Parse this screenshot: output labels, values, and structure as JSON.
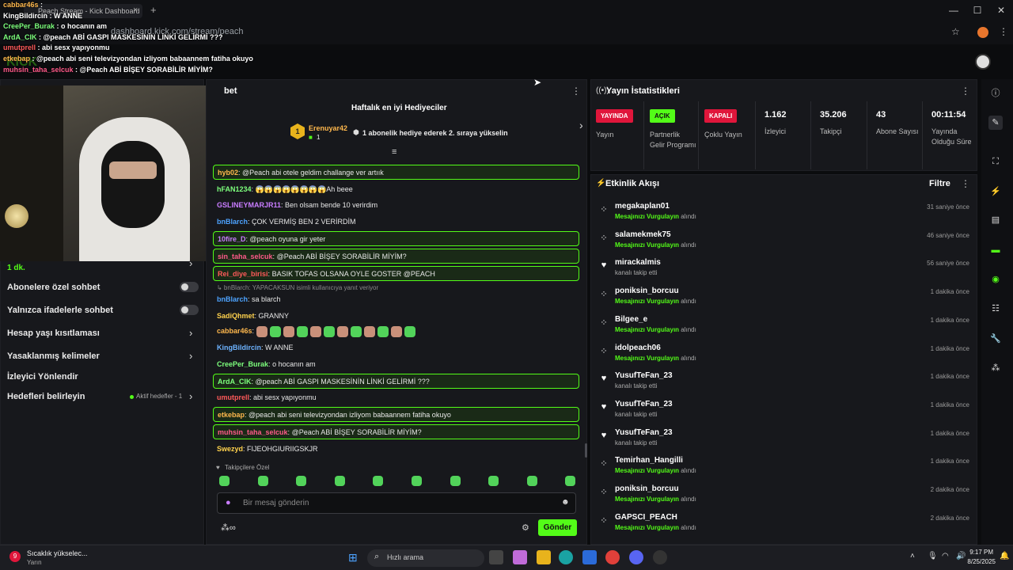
{
  "browser": {
    "tab_title": "Peach Stream - Kick Dashboard",
    "url": "dashboard.kick.com/stream/peach"
  },
  "overlay_chat": [
    {
      "user": "cabbar46s",
      "text": "",
      "color": "#ffb84d"
    },
    {
      "user": "KingBildircin",
      "text": "W ANNE",
      "color": "#ffffff"
    },
    {
      "user": "CreePer_Burak",
      "text": "o hocanın am",
      "color": "#7dff7d"
    },
    {
      "user": "ArdA_CIK",
      "text": "@peach ABİ GASPI MASKESİNİN LİNKİ GELİRMİ ???",
      "color": "#7dff7d"
    },
    {
      "user": "umutprell",
      "text": "abi sesx yapıyonmu",
      "color": "#ff5a5a"
    },
    {
      "user": "etkebap",
      "text": "@peach abi seni televizyondan izliyom babaannem fatiha okuyo",
      "color": "#ffb84d"
    },
    {
      "user": "muhsin_taha_selcuk",
      "text": "@Peach ABİ BİŞEY SORABİLİR MİYİM?",
      "color": "#ff5a8a"
    }
  ],
  "chat_panel": {
    "title": "Sohbet",
    "top_gifters_title": "Haftalık en iyi Hediyeciler",
    "top_gifter_name": "Erenuyar42",
    "top_gifter_count": "1",
    "rank_text": "1 abonelik hediye ederek 2. sıraya yükselin",
    "messages": [
      {
        "user": "hyb02",
        "text": "@Peach abi otele geldim challange ver artıık",
        "color": "#ffb84d",
        "hl": true
      },
      {
        "user": "hFAN1234",
        "text": "😱😱😱😱😱😱😱😱Ah beee",
        "color": "#7dff7d",
        "hl": false
      },
      {
        "user": "GSLINEYMARJR11",
        "text": "Ben olsam bende 10 verirdim",
        "color": "#c97dff",
        "hl": false
      },
      {
        "user": "bnBlarch",
        "text": "ÇOK VERMİŞ BEN 2 VERİRDİM",
        "color": "#4da3ff",
        "hl": false
      },
      {
        "user": "10fire_D",
        "text": "@peach oyuna gir yeter",
        "color": "#c97dff",
        "hl": true
      },
      {
        "user": "sin_taha_selcuk",
        "text": "@Peach ABİ BİŞEY SORABİLİR MİYİM?",
        "color": "#ff5a8a",
        "hl": true
      },
      {
        "user": "Rei_diye_birisi",
        "text": "BASIK TOFAS OLSANA OYLE GOSTER @PEACH",
        "color": "#ff5a5a",
        "hl": true
      },
      {
        "user": "",
        "text": "↳ bnBlarch: YAPACAKSUN isimli kullanıcıya yanıt veriyor",
        "color": "#8a8a8a",
        "hl": false,
        "reply": true
      },
      {
        "user": "bnBlarch",
        "text": "sa blarch",
        "color": "#4da3ff",
        "hl": false
      },
      {
        "user": "SadiQhmet",
        "text": "GRANNY",
        "color": "#ffd24d",
        "hl": false
      },
      {
        "user": "cabbar46s",
        "text": "",
        "color": "#ffb84d",
        "hl": false,
        "emotes": 12
      },
      {
        "user": "KingBildircin",
        "text": "W ANNE",
        "color": "#6db3ff",
        "hl": false
      },
      {
        "user": "CreePer_Burak",
        "text": "o hocanın am",
        "color": "#7dff7d",
        "hl": false
      },
      {
        "user": "ArdA_CIK",
        "text": "@peach ABİ GASPI MASKESİNİN LİNKİ GELİRMİ ???",
        "color": "#7dff7d",
        "hl": true
      },
      {
        "user": "umutprell",
        "text": "abi sesx yapıyonmu",
        "color": "#ff5a5a",
        "hl": false
      },
      {
        "user": "etkebap",
        "text": "@peach abi seni televizyondan izliyom babaannem fatiha okuyo",
        "color": "#ffb84d",
        "hl": true
      },
      {
        "user": "muhsin_taha_selcuk",
        "text": "@Peach ABİ BİŞEY SORABİLİR MİYİM?",
        "color": "#ff5a8a",
        "hl": true
      },
      {
        "user": "Swezyd",
        "text": "FIJEOHGIURIIGSKJR",
        "color": "#ffd24d",
        "hl": false
      }
    ],
    "followers_only_label": "Takipçilere Özel",
    "input_placeholder": "Bir mesaj gönderin",
    "send_label": "Gönder"
  },
  "settings": {
    "follow_delay": "1 dk.",
    "rows": [
      {
        "label": "Abonelere özel sohbet",
        "type": "toggle"
      },
      {
        "label": "Yalnızca ifadelerle sohbet",
        "type": "toggle"
      },
      {
        "label": "Hesap yaşı kısıtlaması",
        "type": "chevron"
      },
      {
        "label": "Yasaklanmış kelimeler",
        "type": "chevron"
      },
      {
        "label": "İzleyici Yönlendir",
        "type": "none"
      },
      {
        "label": "Hedefleri belirleyin",
        "type": "chevron",
        "extra": "Aktif hedefler - 1"
      }
    ]
  },
  "stats": {
    "title": "Yayın İstatistikleri",
    "items": [
      {
        "badge": "YAYINDA",
        "badge_color": "#e0163b",
        "label": "Yayın"
      },
      {
        "badge": "AÇIK",
        "badge_color": "#53fc18",
        "label": "Partnerlik Gelir Programı"
      },
      {
        "badge": "KAPALI",
        "badge_color": "#e0163b",
        "label": "Çoklu Yayın"
      },
      {
        "value": "1.162",
        "label": "İzleyici"
      },
      {
        "value": "35.206",
        "label": "Takipçi"
      },
      {
        "value": "43",
        "label": "Abone Sayısı"
      },
      {
        "value": "00:11:54",
        "label": "Yayında Olduğu Süre"
      }
    ]
  },
  "events": {
    "title": "Etkinlik Akışı",
    "filter_label": "Filtre",
    "items": [
      {
        "name": "megakaplan01",
        "type": "msg",
        "time": "31 saniye önce"
      },
      {
        "name": "salamekmek75",
        "type": "msg",
        "time": "46 saniye önce"
      },
      {
        "name": "mirackalmis",
        "type": "follow",
        "time": "56 saniye önce"
      },
      {
        "name": "poniksin_borcuu",
        "type": "msg",
        "time": "1 dakika önce"
      },
      {
        "name": "Bilgee_e",
        "type": "msg",
        "time": "1 dakika önce"
      },
      {
        "name": "idolpeach06",
        "type": "msg",
        "time": "1 dakika önce"
      },
      {
        "name": "YusufTeFan_23",
        "type": "follow",
        "time": "1 dakika önce"
      },
      {
        "name": "YusufTeFan_23",
        "type": "follow",
        "time": "1 dakika önce"
      },
      {
        "name": "YusufTeFan_23",
        "type": "follow",
        "time": "1 dakika önce"
      },
      {
        "name": "Temirhan_Hangilli",
        "type": "msg",
        "time": "1 dakika önce"
      },
      {
        "name": "poniksin_borcuu",
        "type": "msg",
        "time": "2 dakika önce"
      },
      {
        "name": "GAPSCI_PEACH",
        "type": "msg",
        "time": "2 dakika önce"
      }
    ],
    "msg_highlight": "Mesajınızı Vurgulayın",
    "msg_suffix": "alındı",
    "follow_text": "kanalı takip etti"
  },
  "taskbar": {
    "weather_title": "Sıcaklık yükselec...",
    "weather_sub": "Yarın",
    "weather_temp": "9",
    "search_placeholder": "Hızlı arama",
    "time": "9:17 PM",
    "date": "8/25/2025"
  }
}
